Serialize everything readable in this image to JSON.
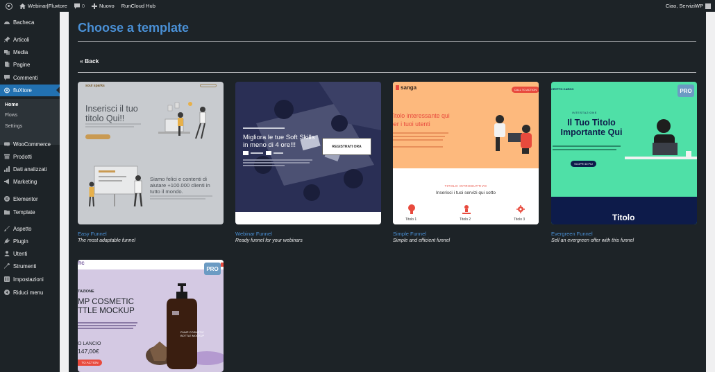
{
  "adminbar": {
    "site_name": "Webinar|Fluxtore",
    "comments_count": "0",
    "new_label": "Nuovo",
    "runcloud_label": "RunCloud Hub",
    "greeting": "Ciao, ServiziWP"
  },
  "sidebar": {
    "items": [
      {
        "label": "Bacheca",
        "icon": "dashboard-icon"
      },
      {
        "label": "Articoli",
        "icon": "pin-icon"
      },
      {
        "label": "Media",
        "icon": "media-icon"
      },
      {
        "label": "Pagine",
        "icon": "pages-icon"
      },
      {
        "label": "Commenti",
        "icon": "comment-icon"
      },
      {
        "label": "fluXtore",
        "icon": "fluxtore-icon"
      },
      {
        "label": "WooCommerce",
        "icon": "woocommerce-icon"
      },
      {
        "label": "Prodotti",
        "icon": "products-icon"
      },
      {
        "label": "Dati analizzati",
        "icon": "analytics-icon"
      },
      {
        "label": "Marketing",
        "icon": "megaphone-icon"
      },
      {
        "label": "Elementor",
        "icon": "elementor-icon"
      },
      {
        "label": "Template",
        "icon": "folder-icon"
      },
      {
        "label": "Aspetto",
        "icon": "brush-icon"
      },
      {
        "label": "Plugin",
        "icon": "plugin-icon"
      },
      {
        "label": "Utenti",
        "icon": "user-icon"
      },
      {
        "label": "Strumenti",
        "icon": "wrench-icon"
      },
      {
        "label": "Impostazioni",
        "icon": "settings-icon"
      },
      {
        "label": "Riduci menu",
        "icon": "collapse-icon"
      }
    ],
    "submenu": [
      {
        "label": "Home"
      },
      {
        "label": "Flows"
      },
      {
        "label": "Settings"
      }
    ]
  },
  "main": {
    "title": "Choose a template",
    "back_label": "« Back",
    "pro_label": "PRO",
    "templates": [
      {
        "title": "Easy Funnel",
        "description": "The most adaptable funnel"
      },
      {
        "title": "Webinar Funnel",
        "description": "Ready funnel for your webinars"
      },
      {
        "title": "Simple Funnel",
        "description": "Simple and efficient funnel"
      },
      {
        "title": "Evergreen Funnel",
        "description": "Sell an evergreen offer with this funnel"
      },
      {
        "title": "",
        "description": ""
      }
    ]
  },
  "previews": {
    "easy": {
      "logo": "soul sparks",
      "heading": "Inserisci il tuo titolo Qui!!",
      "subheading": "Siamo felici e contenti di aiutare +100.000 clienti in tutto il mondo."
    },
    "webinar": {
      "heading": "Migliora le tue Soft Skills in meno di 4 ore!!!",
      "button": "REGISTRATI ORA"
    },
    "simple": {
      "brand": "sanga",
      "cta": "CALL TO ACTION",
      "heading": "Titolo interessante qui per i tuoi utenti",
      "kicker": "TITOLO INTRODUTTIVO",
      "section": "Inserisci i tuoi servizi qui sotto",
      "items": [
        "Titolo 1",
        "Titolo 2",
        "Titolo 3"
      ]
    },
    "evergreen": {
      "brand": "CRYPTO CARGO",
      "kicker": "INTESTAZIONE",
      "heading": "Il Tuo Titolo Importante Qui",
      "button": "SCOPRI DI PIU",
      "footer": "Titolo"
    },
    "cosmetic": {
      "brand": "TIC",
      "kicker": "TAZIONE",
      "heading": "MP COSMETIC TTLE MOCKUP",
      "bottle_label": "PUMP COSMETIC BOTTLE MOCKUP",
      "launch": "O LANCIO",
      "price": "147,00€",
      "cta": "TO ACTION"
    }
  },
  "colors": {
    "accent": "#2271b1",
    "title_blue": "#4a90d6",
    "admin_bg": "#1d2327",
    "pro_badge": "#6b9bc3",
    "simple_orange": "#fdb97d",
    "simple_red": "#e84a3d",
    "evergreen_green": "#4fe0a7",
    "evergreen_navy": "#0d1b4a"
  }
}
